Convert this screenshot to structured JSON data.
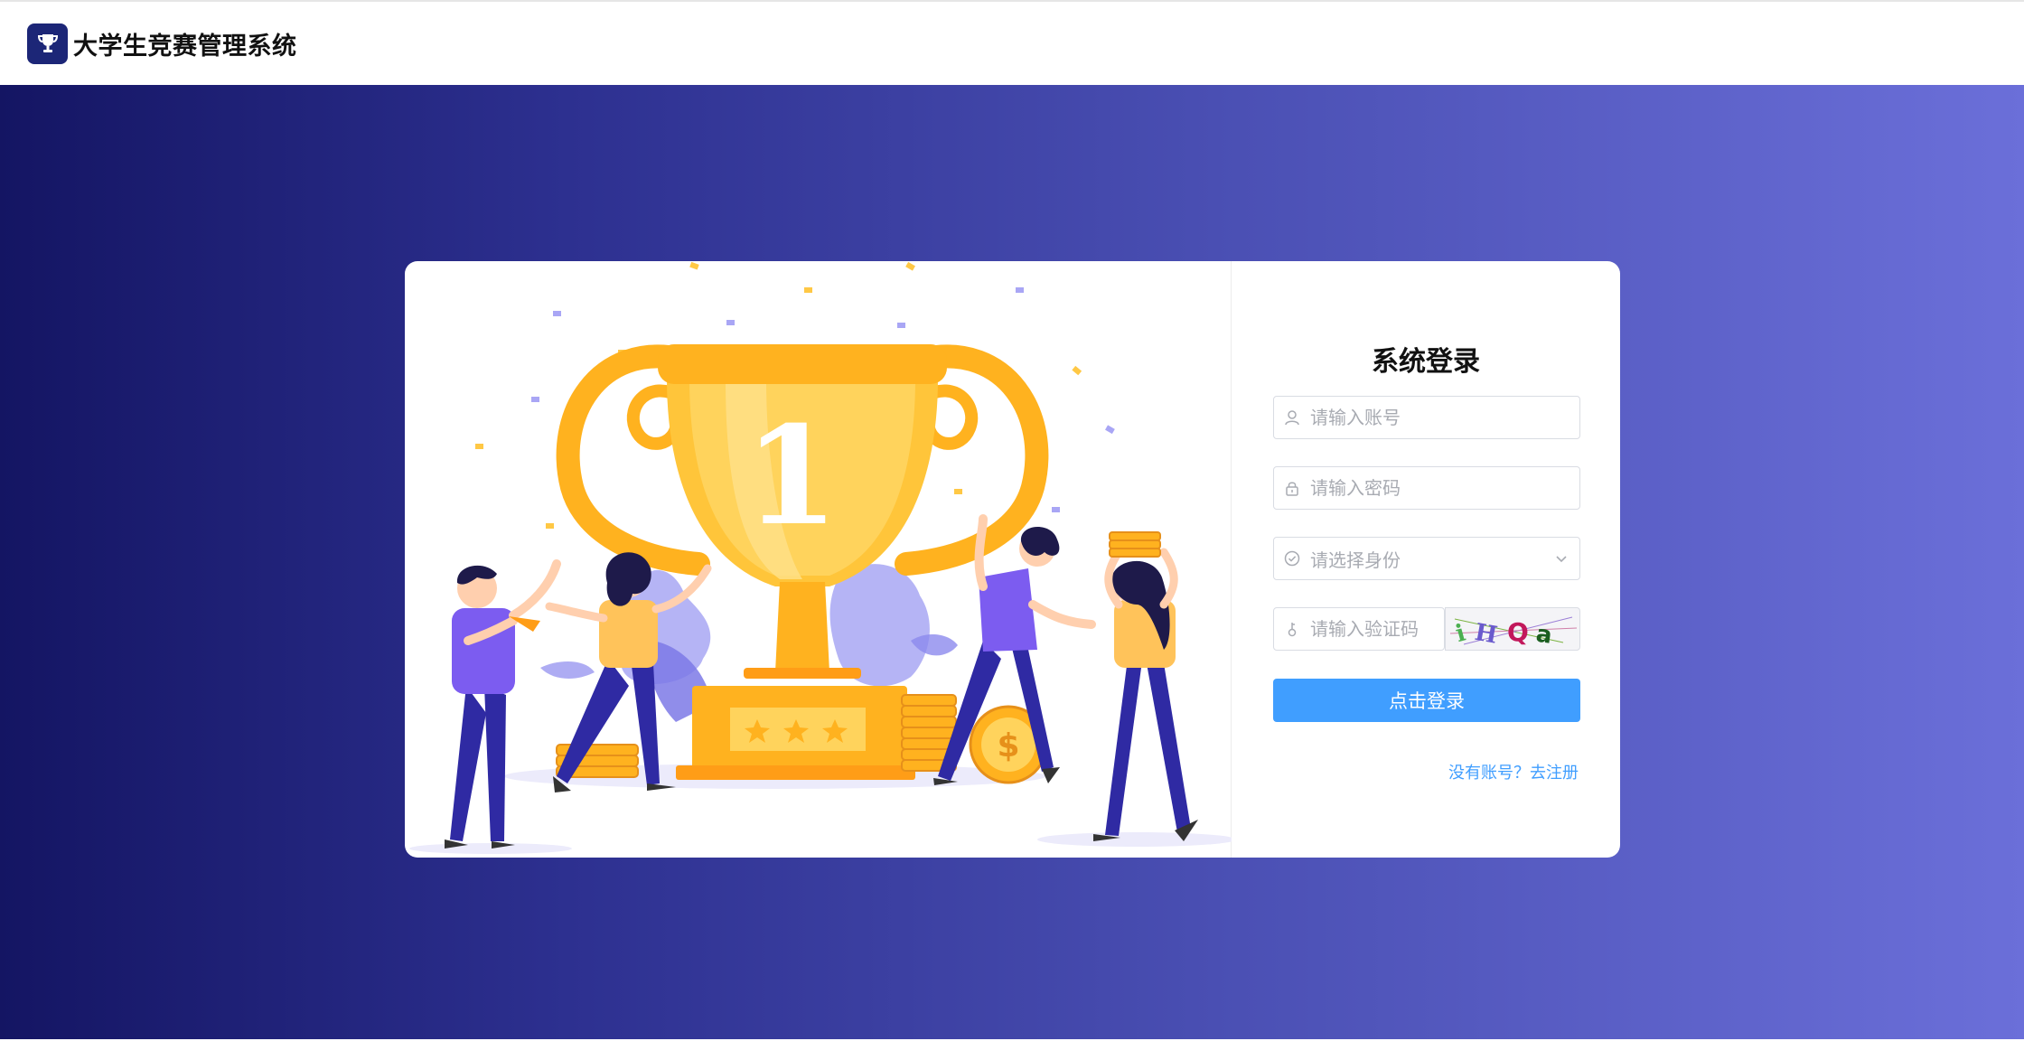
{
  "app": {
    "title": "大学生竞赛管理系统"
  },
  "login": {
    "title": "系统登录",
    "account_placeholder": "请输入账号",
    "password_placeholder": "请输入密码",
    "role_placeholder": "请选择身份",
    "captcha_placeholder": "请输入验证码",
    "captcha_text": "iHQa",
    "submit_label": "点击登录",
    "register_link": "没有账号？去注册"
  },
  "illustration": {
    "trophy_number": "1"
  },
  "colors": {
    "brand": "#1c2677",
    "primary": "#409eff",
    "gradient_start": "#141563",
    "gradient_end": "#6b6fd9",
    "trophy": "#ffb21f"
  },
  "icons": [
    "trophy-icon",
    "user-icon",
    "lock-icon",
    "check-circle-icon",
    "chevron-down-icon",
    "key-icon"
  ]
}
